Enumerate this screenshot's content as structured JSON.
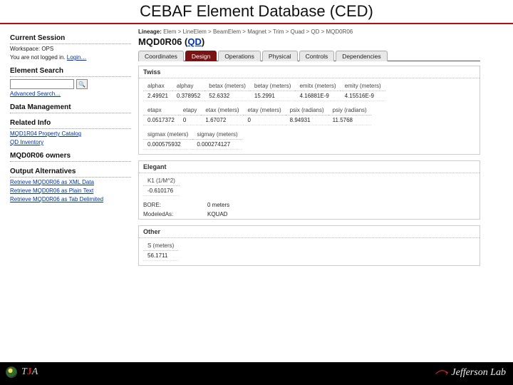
{
  "title": "CEBAF Element Database (CED)",
  "sidebar": {
    "session_head": "Current Session",
    "workspace_label": "Workspace:",
    "workspace_value": "OPS",
    "login_text": "You are not logged in.",
    "login_link": "Login…",
    "search_head": "Element Search",
    "search_placeholder": "",
    "advanced_search": "Advanced Search…",
    "data_head": "Data Management",
    "related_head": "Related Info",
    "related_1": "MQD1R04 Property Catalog",
    "related_2": "QD Inventory",
    "owners_head": "MQD0R06 owners",
    "output_head": "Output Alternatives",
    "out_1": "Retrieve MQD0R06 as XML Data",
    "out_2": "Retrieve MQD0R06 as Plain Text",
    "out_3": "Retrieve MQD0R06 as Tab Delimited"
  },
  "main": {
    "lineage_label": "Lineage:",
    "lineage_path": "Elem > LineElem > BeamElem > Magnet > Trim > Quad > QD > MQD0R06",
    "element_name": "MQD0R06",
    "element_type": "QD",
    "tabs": [
      "Coordinates",
      "Design",
      "Operations",
      "Physical",
      "Controls",
      "Dependencies"
    ],
    "active_tab_index": 1,
    "twiss": {
      "title": "Twiss",
      "row1": {
        "headers": [
          "alphax",
          "alphay",
          "betax\n(meters)",
          "betay\n(meters)",
          "emitx\n(meters)",
          "emity\n(meters)"
        ],
        "values": [
          "2.49921",
          "0.378952",
          "52.6332",
          "15.2991",
          "4.16881E-9",
          "4.15516E-9"
        ]
      },
      "row2": {
        "headers": [
          "etapx",
          "etapy",
          "etax\n(meters)",
          "etay\n(meters)",
          "psix\n(radians)",
          "psiy\n(radians)"
        ],
        "values": [
          "0.0517372",
          "0",
          "1.67072",
          "0",
          "8.94931",
          "11.5768"
        ]
      },
      "row3": {
        "headers": [
          "sigmax\n(meters)",
          "sigmay\n(meters)"
        ],
        "values": [
          "0.000575932",
          "0.000274127"
        ]
      }
    },
    "elegant": {
      "title": "Elegant",
      "k1_head": "K1\n(1/M^2)",
      "k1_val": "-0.610176",
      "bore_label": "BORE:",
      "bore_val": "0 meters",
      "modeled_label": "ModeledAs:",
      "modeled_val": "KQUAD"
    },
    "other": {
      "title": "Other",
      "s_head": "S\n(meters)",
      "s_val": "56.1711"
    }
  },
  "footer": {
    "left_text": "TJA",
    "right_text": "Jefferson Lab"
  }
}
